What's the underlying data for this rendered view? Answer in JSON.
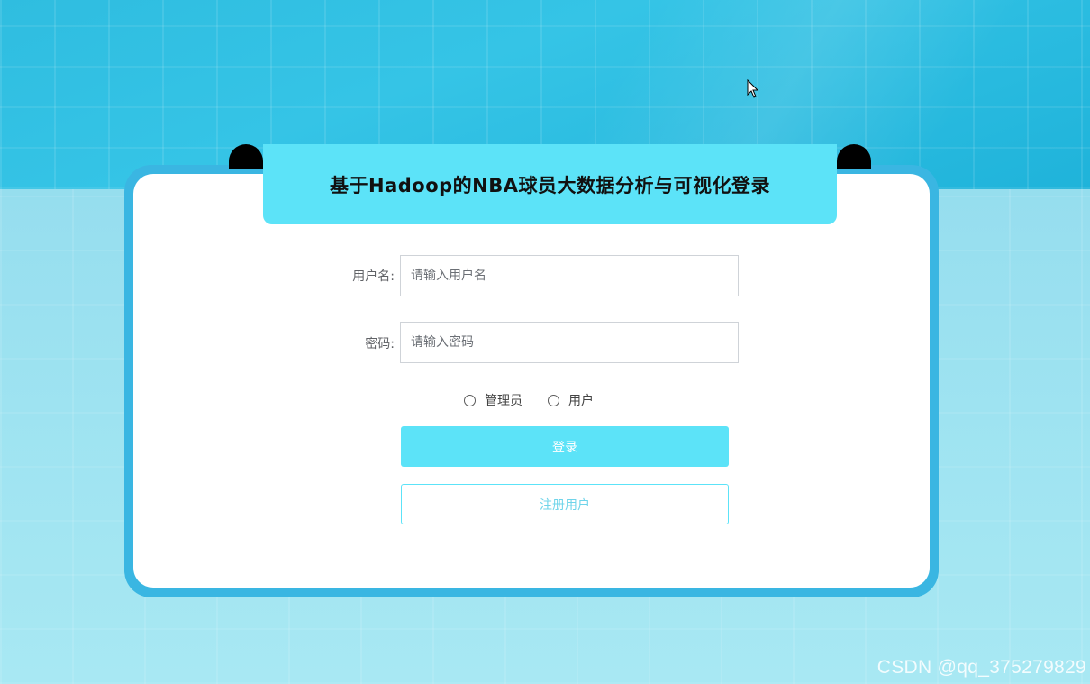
{
  "login": {
    "title": "基于Hadoop的NBA球员大数据分析与可视化登录",
    "username_label": "用户名:",
    "username_placeholder": "请输入用户名",
    "username_value": "",
    "password_label": "密码:",
    "password_placeholder": "请输入密码",
    "password_value": "",
    "roles": [
      {
        "label": "管理员",
        "selected": false
      },
      {
        "label": "用户",
        "selected": false
      }
    ],
    "login_button": "登录",
    "register_button": "注册用户"
  },
  "watermark": "CSDN @qq_375279829",
  "colors": {
    "accent": "#5ce3f8",
    "frame": "#3ab6e2"
  }
}
